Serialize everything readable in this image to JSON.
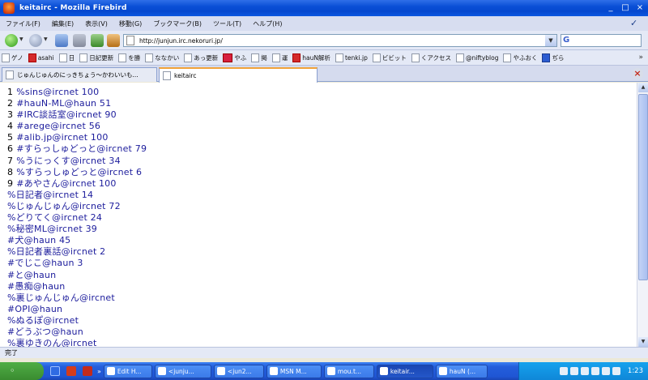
{
  "window": {
    "title": "keitairc - Mozilla Firebird",
    "controls": [
      "_",
      "□",
      "×"
    ]
  },
  "menu": [
    "ファイル(F)",
    "編集(E)",
    "表示(V)",
    "移動(G)",
    "ブックマーク(B)",
    "ツール(T)",
    "ヘルプ(H)"
  ],
  "navigation": {
    "url": "http://junjun.irc.nekoruri.jp/",
    "search_value": "",
    "buttons": [
      "back-icon",
      "forward-icon",
      "reload-icon",
      "stop-icon",
      "home-icon"
    ]
  },
  "bookmarks": [
    "ゲノ",
    "asahi",
    "日",
    "日記更新",
    "を勝",
    "ななかい",
    "あっ更新",
    "やふ",
    "掲",
    "運",
    "hauN解析",
    "tenki.jp",
    "ビビット",
    "くアクセス",
    "@niftyblog",
    "やふおく",
    "ぢら"
  ],
  "tabs": [
    {
      "label": "じゅんじゅんのにっきちょう〜かわいいも..."
    },
    {
      "label": "keitairc"
    }
  ],
  "channels": [
    {
      "num": "1",
      "name": "%sins@ircnet 100"
    },
    {
      "num": "2",
      "name": "#hauN-ML@haun 51"
    },
    {
      "num": "3",
      "name": "#IRC談話室@ircnet 90"
    },
    {
      "num": "4",
      "name": "#arege@ircnet 56"
    },
    {
      "num": "5",
      "name": "#alib.jp@ircnet 100"
    },
    {
      "num": "6",
      "name": "#すらっしゅどっと@ircnet 79"
    },
    {
      "num": "7",
      "name": "%うにっくす@ircnet 34"
    },
    {
      "num": "8",
      "name": "%すらっしゅどっと@ircnet 6"
    },
    {
      "num": "9",
      "name": "#あやさん@ircnet 100"
    },
    {
      "num": "",
      "name": "%日記者@ircnet 14"
    },
    {
      "num": "",
      "name": "%じゅんじゅん@ircnet 72"
    },
    {
      "num": "",
      "name": "%どりてく@ircnet 24"
    },
    {
      "num": "",
      "name": "%秘密ML@ircnet 39"
    },
    {
      "num": "",
      "name": "#犬@haun 45"
    },
    {
      "num": "",
      "name": "%日記者裏話@ircnet 2"
    },
    {
      "num": "",
      "name": "#でじこ@haun 3"
    },
    {
      "num": "",
      "name": "#と@haun"
    },
    {
      "num": "",
      "name": "#愚痴@haun"
    },
    {
      "num": "",
      "name": "%裏じゅんじゅん@ircnet"
    },
    {
      "num": "",
      "name": "#OPI@haun"
    },
    {
      "num": "",
      "name": "%ぬるぽ@ircnet"
    },
    {
      "num": "",
      "name": "#どうぶつ@haun"
    },
    {
      "num": "",
      "name": "%裏ゆきのん@ircnet"
    }
  ],
  "status": "完了",
  "taskbar": {
    "start": "",
    "items": [
      "Edit H...",
      "<junju...",
      "<jun2...",
      "MSN M...",
      "mou.t...",
      "keitair...",
      "hauN (..."
    ],
    "active_index": 5,
    "clock": "1:23"
  }
}
